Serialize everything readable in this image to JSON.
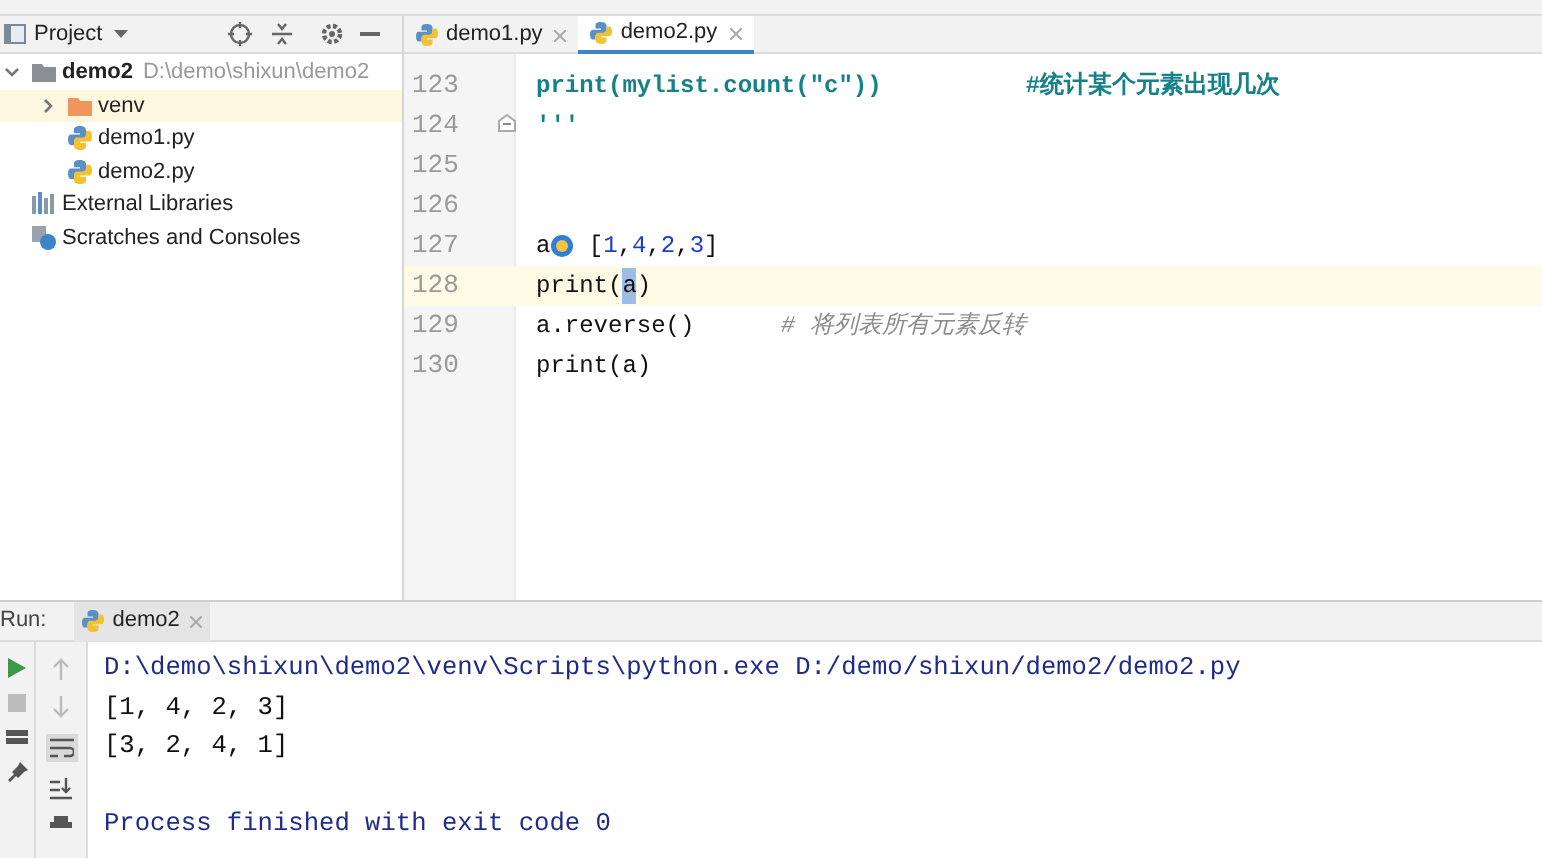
{
  "sidebar": {
    "title": "Project",
    "tree": [
      {
        "label": "demo2",
        "path": "D:\\demo\\shixun\\demo2",
        "kind": "project",
        "expanded": true,
        "selected": false,
        "children": [
          {
            "label": "venv",
            "kind": "folder",
            "expanded": false,
            "selected": true
          },
          {
            "label": "demo1.py",
            "kind": "py",
            "selected": false
          },
          {
            "label": "demo2.py",
            "kind": "py",
            "selected": false
          }
        ]
      },
      {
        "label": "External Libraries",
        "kind": "libs",
        "selected": false
      },
      {
        "label": "Scratches and Consoles",
        "kind": "scratch",
        "selected": false
      }
    ]
  },
  "editor": {
    "tabs": [
      {
        "label": "demo1.py",
        "selected": false
      },
      {
        "label": "demo2.py",
        "selected": true
      }
    ],
    "lines": [
      {
        "number": "123",
        "current": false,
        "fold": false,
        "tokens": [
          {
            "text": "print(mylist.count(\"c\"))          ",
            "kind": "docstring"
          },
          {
            "text": "#统计某个元素出现几次",
            "kind": "docstring"
          }
        ]
      },
      {
        "number": "124",
        "current": false,
        "fold": true,
        "tokens": [
          {
            "text": "'''",
            "kind": "docstring"
          }
        ]
      },
      {
        "number": "125",
        "current": false,
        "fold": false
      },
      {
        "number": "126",
        "current": false,
        "fold": false
      },
      {
        "number": "127",
        "current": false,
        "fold": false,
        "tokens": [
          {
            "text": "a",
            "kind": "code"
          },
          {
            "kind": "intention"
          },
          {
            "text": " [",
            "kind": "code"
          },
          {
            "text": "1",
            "kind": "number"
          },
          {
            "text": ",",
            "kind": "code"
          },
          {
            "text": "4",
            "kind": "number"
          },
          {
            "text": ",",
            "kind": "code"
          },
          {
            "text": "2",
            "kind": "number"
          },
          {
            "text": ",",
            "kind": "code"
          },
          {
            "text": "3",
            "kind": "number"
          },
          {
            "text": "]",
            "kind": "code"
          }
        ]
      },
      {
        "number": "128",
        "current": true,
        "fold": false,
        "tokens": [
          {
            "text": "print(",
            "kind": "code"
          },
          {
            "text": "a",
            "kind": "highlight"
          },
          {
            "text": ")",
            "kind": "code"
          }
        ]
      },
      {
        "number": "129",
        "current": false,
        "fold": false,
        "tokens": [
          {
            "text": "a.reverse()      ",
            "kind": "code"
          },
          {
            "text": "# 将列表所有元素反转",
            "kind": "comment"
          }
        ]
      },
      {
        "number": "130",
        "current": false,
        "fold": false,
        "tokens": [
          {
            "text": "print(a)",
            "kind": "code"
          }
        ]
      }
    ]
  },
  "run_panel": {
    "label": "Run:",
    "tab": "demo2",
    "output": [
      {
        "text": "D:\\demo\\shixun\\demo2\\venv\\Scripts\\python.exe D:/demo/shixun/demo2/demo2.py",
        "kind": "system"
      },
      {
        "text": "[1, 4, 2, 3]",
        "kind": "stdout"
      },
      {
        "text": "[3, 2, 4, 1]",
        "kind": "stdout"
      },
      {
        "kind": "blank"
      },
      {
        "text": "Process finished with exit code 0",
        "kind": "system"
      }
    ]
  }
}
